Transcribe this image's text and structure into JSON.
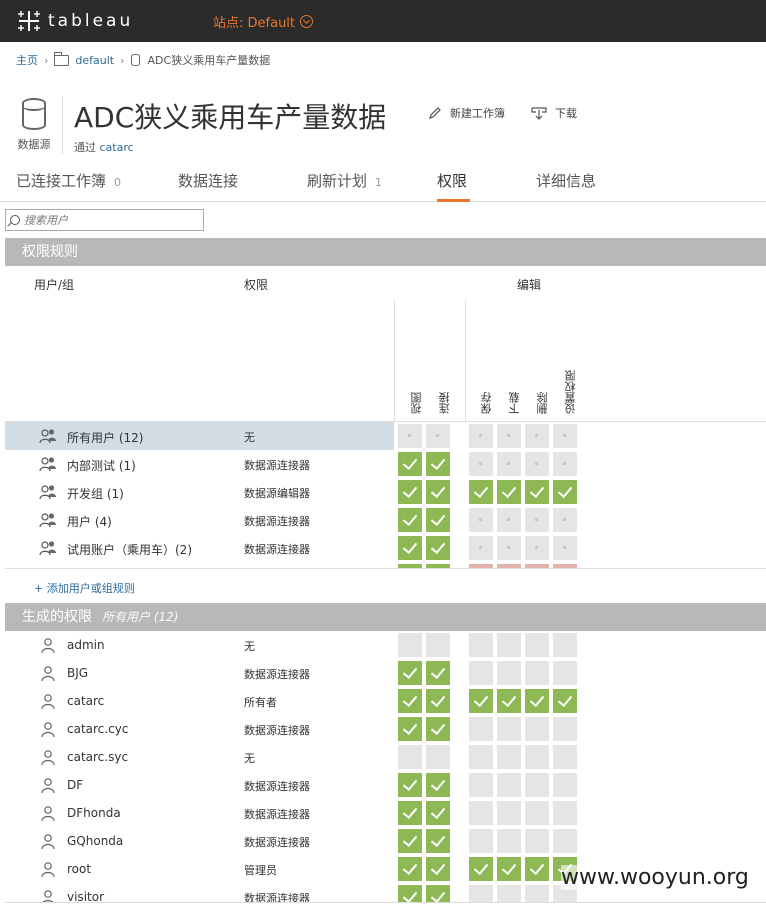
{
  "topbar": {
    "logo_text": "tableau",
    "site_label": "站点: Default"
  },
  "breadcrumb": {
    "home": "主页",
    "folder": "default",
    "current": "ADC狭义乘用车产量数据"
  },
  "header": {
    "icon_caption": "数据源",
    "title": "ADC狭义乘用车产量数据",
    "via_prefix": "通过",
    "owner": "catarc",
    "new_workbook": "新建工作簿",
    "download": "下载"
  },
  "tabs": [
    {
      "label": "已连接工作簿",
      "count": "0"
    },
    {
      "label": "数据连接",
      "count": ""
    },
    {
      "label": "刷新计划",
      "count": "1"
    },
    {
      "label": "权限",
      "count": ""
    },
    {
      "label": "详细信息",
      "count": ""
    }
  ],
  "search": {
    "placeholder": "搜索用户"
  },
  "rules_section": {
    "title": "权限规则",
    "col_user": "用户/组",
    "col_perm": "权限",
    "col_edit": "编辑",
    "cap_labels": [
      "视图",
      "连接",
      "保存",
      "下载",
      "删除",
      "设置权限"
    ],
    "rows": [
      {
        "name": "所有用户 (12)",
        "perm": "无",
        "caps": [
          "none",
          "none",
          "none",
          "none",
          "none",
          "none"
        ],
        "selected": true
      },
      {
        "name": "内部测试 (1)",
        "perm": "数据源连接器",
        "caps": [
          "allow",
          "allow",
          "none",
          "none",
          "none",
          "none"
        ]
      },
      {
        "name": "开发组 (1)",
        "perm": "数据源编辑器",
        "caps": [
          "allow",
          "allow",
          "allow",
          "allow",
          "allow",
          "allow"
        ]
      },
      {
        "name": "用户 (4)",
        "perm": "数据源连接器",
        "caps": [
          "allow",
          "allow",
          "none",
          "none",
          "none",
          "none"
        ]
      },
      {
        "name": "试用账户（乘用车）(2)",
        "perm": "数据源连接器",
        "caps": [
          "allow",
          "allow",
          "none",
          "none",
          "none",
          "none"
        ]
      },
      {
        "name": "",
        "perm": "",
        "caps": [
          "allow",
          "allow",
          "deny",
          "deny",
          "deny",
          "deny"
        ]
      }
    ],
    "add_rule": "+ 添加用户或组规则"
  },
  "effective_section": {
    "title": "生成的权限",
    "subtitle": "所有用户 (12)",
    "rows": [
      {
        "name": "admin",
        "perm": "无",
        "caps": [
          "none",
          "none",
          "none",
          "none",
          "none",
          "none"
        ]
      },
      {
        "name": "BJG",
        "perm": "数据源连接器",
        "caps": [
          "allow",
          "allow",
          "none",
          "none",
          "none",
          "none"
        ]
      },
      {
        "name": "catarc",
        "perm": "所有者",
        "caps": [
          "allow",
          "allow",
          "allow",
          "allow",
          "allow",
          "allow"
        ]
      },
      {
        "name": "catarc.cyc",
        "perm": "数据源连接器",
        "caps": [
          "allow",
          "allow",
          "none",
          "none",
          "none",
          "none"
        ]
      },
      {
        "name": "catarc.syc",
        "perm": "无",
        "caps": [
          "none",
          "none",
          "none",
          "none",
          "none",
          "none"
        ]
      },
      {
        "name": "DF",
        "perm": "数据源连接器",
        "caps": [
          "allow",
          "allow",
          "none",
          "none",
          "none",
          "none"
        ]
      },
      {
        "name": "DFhonda",
        "perm": "数据源连接器",
        "caps": [
          "allow",
          "allow",
          "none",
          "none",
          "none",
          "none"
        ]
      },
      {
        "name": "GQhonda",
        "perm": "数据源连接器",
        "caps": [
          "allow",
          "allow",
          "none",
          "none",
          "none",
          "none"
        ]
      },
      {
        "name": "root",
        "perm": "管理员",
        "caps": [
          "allow",
          "allow",
          "allow",
          "allow",
          "allow",
          "allow"
        ]
      },
      {
        "name": "visitor",
        "perm": "数据源连接器",
        "caps": [
          "allow",
          "allow",
          "none",
          "none",
          "none",
          "none"
        ]
      }
    ]
  },
  "watermark": "www.wooyun.org",
  "colors": {
    "accent": "#e8762c",
    "allow": "#8db853",
    "deny": "#e3b3ab",
    "none": "#e5e5e5",
    "link": "#2d6b9b"
  }
}
